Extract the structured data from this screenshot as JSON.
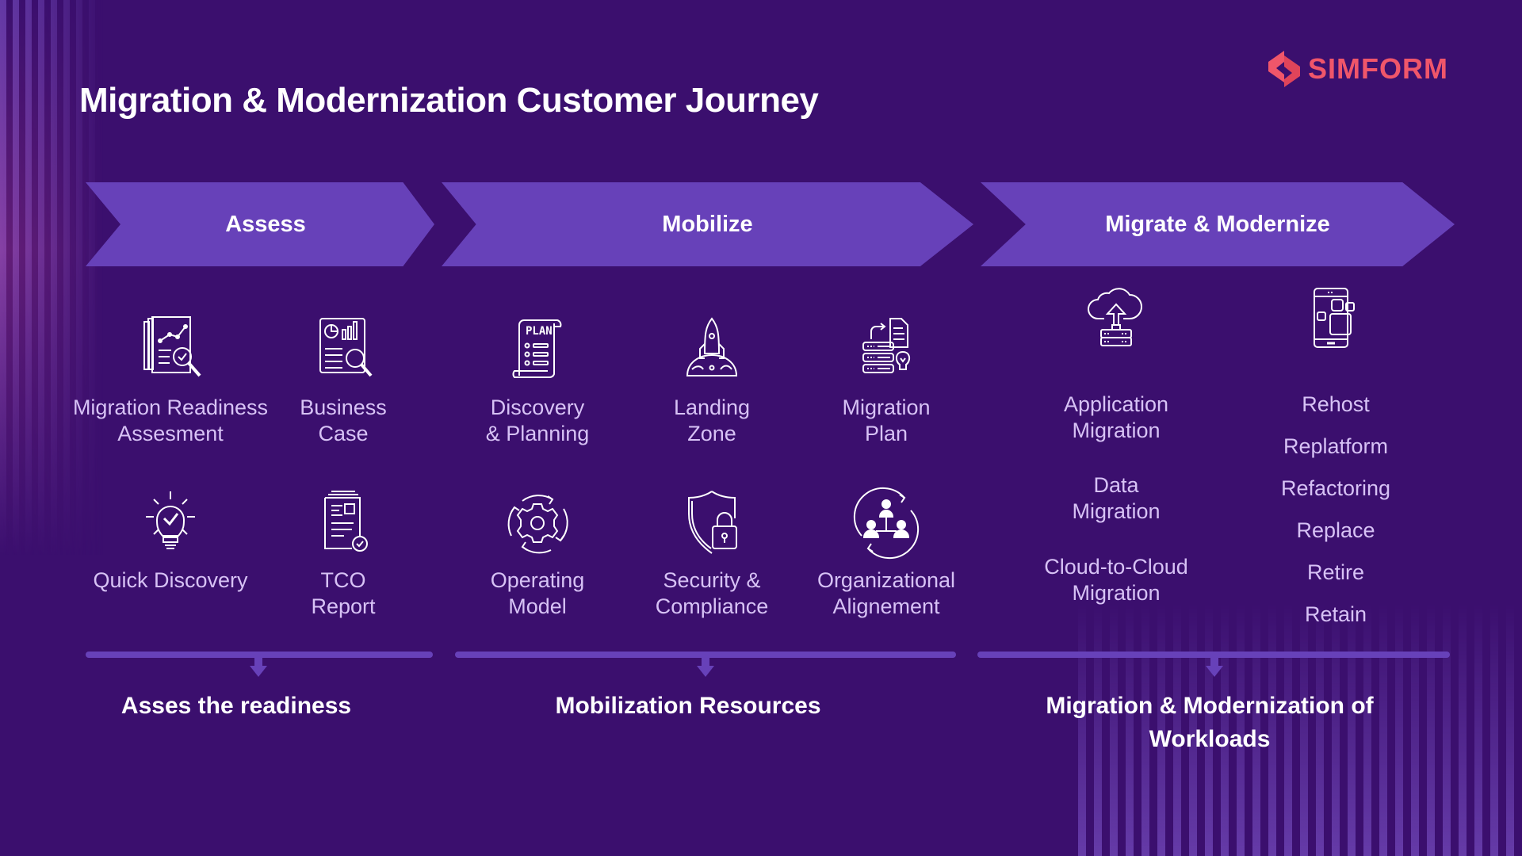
{
  "title": "Migration & Modernization Customer Journey",
  "logo": {
    "text": "SIMFORM",
    "icon": "simform-logo-icon",
    "color": "#f0566a"
  },
  "colors": {
    "background": "#3b0f6e",
    "accent": "#6741b9",
    "label": "#d7c2f5",
    "heading": "#ffffff"
  },
  "phases": [
    {
      "name": "Assess",
      "items": [
        {
          "label": "Migration Readiness\nAssesment",
          "icon": "readiness-assessment-icon"
        },
        {
          "label": "Business\nCase",
          "icon": "business-case-icon"
        },
        {
          "label": "Quick Discovery",
          "icon": "lightbulb-check-icon"
        },
        {
          "label": "TCO\nReport",
          "icon": "tco-report-icon"
        }
      ],
      "outcome": "Asses the readiness"
    },
    {
      "name": "Mobilize",
      "items": [
        {
          "label": "Discovery\n& Planning",
          "icon": "plan-scroll-icon"
        },
        {
          "label": "Landing\nZone",
          "icon": "rocket-icon"
        },
        {
          "label": "Migration\nPlan",
          "icon": "server-document-icon"
        },
        {
          "label": "Operating\nModel",
          "icon": "gear-cycle-icon"
        },
        {
          "label": "Security &\nCompliance",
          "icon": "shield-lock-icon"
        },
        {
          "label": "Organizational\nAlignement",
          "icon": "org-cycle-icon"
        }
      ],
      "outcome": "Mobilization Resources"
    },
    {
      "name": "Migrate & Modernize",
      "migration_types": [
        "Application\nMigration",
        "Data\nMigration",
        "Cloud-to-Cloud\nMigration"
      ],
      "strategies": [
        "Rehost",
        "Replatform",
        "Refactoring",
        "Replace",
        "Retire",
        "Retain"
      ],
      "icons": [
        "cloud-upload-server-icon",
        "mobile-app-icon"
      ],
      "outcome": "Migration & Modernization of\nWorkloads"
    }
  ]
}
